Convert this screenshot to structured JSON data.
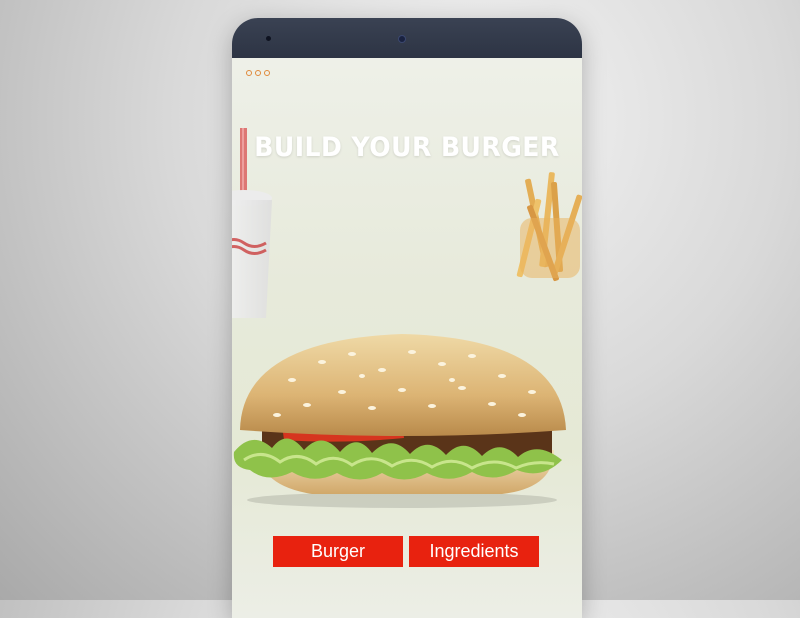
{
  "screen": {
    "title": "BUILD YOUR BURGER",
    "menu_icon": "three-dots-icon"
  },
  "buttons": {
    "burger_label": "Burger",
    "ingredients_label": "Ingredients"
  },
  "colors": {
    "accent": "#e8220f",
    "menu_dots": "#e08a3c",
    "phone_frame": "#2d3444"
  }
}
